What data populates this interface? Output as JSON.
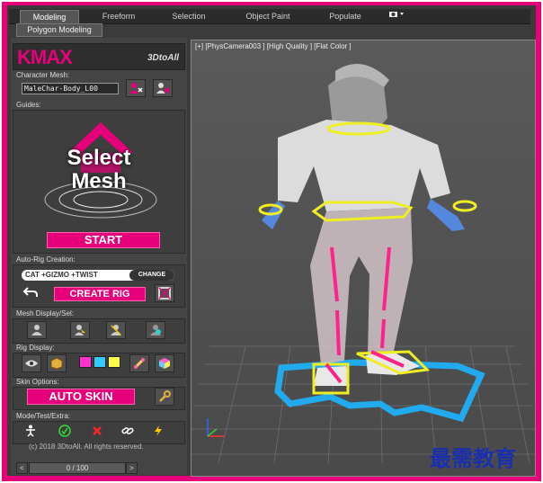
{
  "ribbon": {
    "tabs": [
      {
        "label": "Modeling",
        "active": true
      },
      {
        "label": "Freeform",
        "active": false
      },
      {
        "label": "Selection",
        "active": false
      },
      {
        "label": "Object Paint",
        "active": false
      },
      {
        "label": "Populate",
        "active": false
      }
    ],
    "subtab": "Polygon Modeling"
  },
  "panel": {
    "logo_text": "KMAX",
    "logo_brand": "3DtoAll",
    "character_mesh_label": "Character Mesh:",
    "character_mesh_value": "MaleChar-Body_L00",
    "guides_label": "Guides:",
    "select_line1": "Select",
    "select_line2": "Mesh",
    "start_label": "START",
    "auto_rig_label": "Auto-Rig Creation:",
    "rig_mode_text": "CAT +GIZMO +TWIST",
    "change_label": "CHANGE",
    "create_rig_label": "CREATE RIG",
    "mesh_display_label": "Mesh Display/Sel:",
    "rig_display_label": "Rig Display:",
    "skin_options_label": "Skin Options:",
    "auto_skin_label": "AUTO SKIN",
    "mode_label": "Mode/Test/Extra:",
    "copyright": "(c) 2018 3DtoAll. All rights reserved."
  },
  "rig_swatches": [
    "#ff33cc",
    "#33ccff",
    "#ffff44"
  ],
  "timeline": {
    "frame": "0 / 100",
    "prev": "<",
    "next": ">"
  },
  "viewport": {
    "label": "[+] [PhysCamera003 ] [High Quality ] [Flat Color ]"
  },
  "watermark": "最需教育",
  "colors": {
    "accent": "#e6007a",
    "panel": "#444444",
    "viewport": "#505050"
  }
}
